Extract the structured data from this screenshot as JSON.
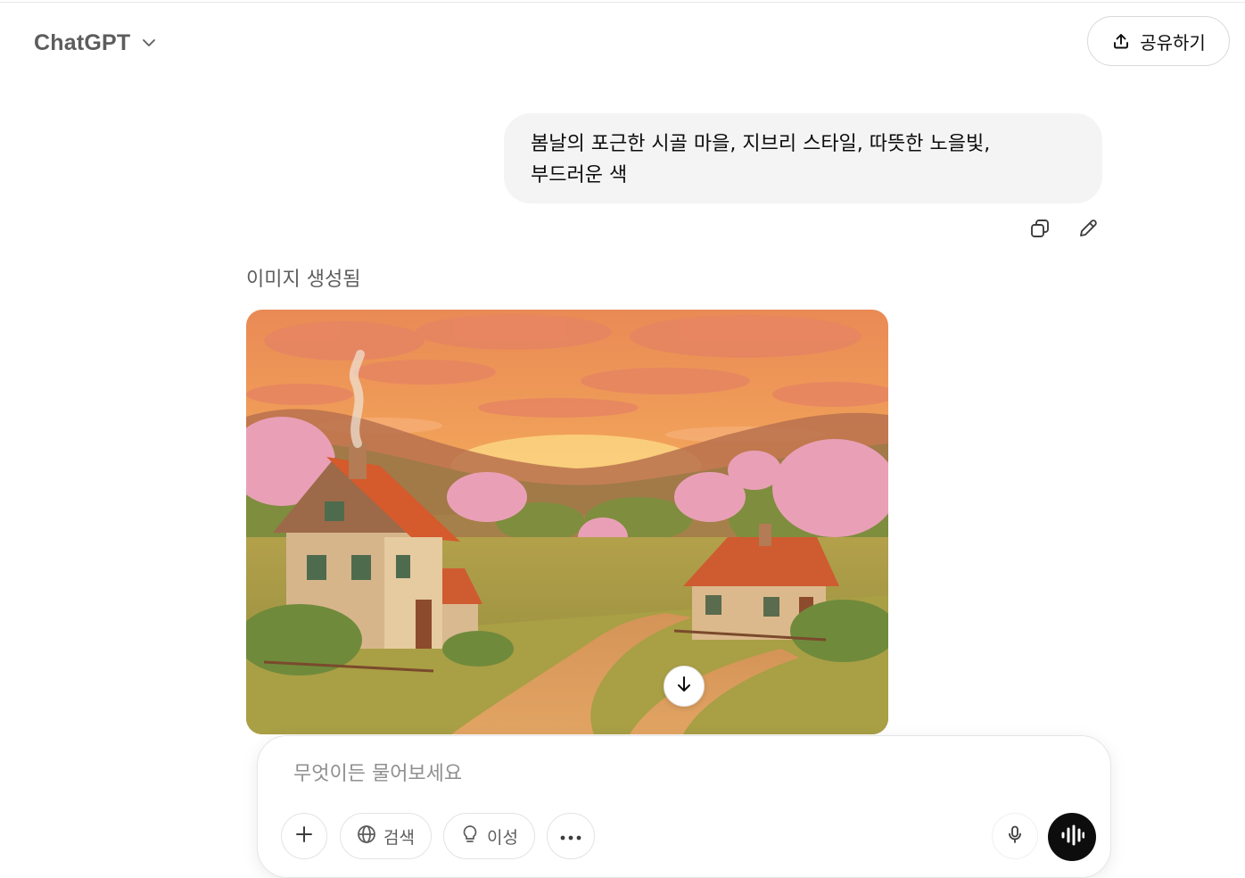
{
  "header": {
    "model_name": "ChatGPT",
    "share_label": "공유하기"
  },
  "conversation": {
    "user_message_lines": [
      "봄날의 포근한 시골 마을, 지브리 스타일, 따뜻한 노을빛,",
      "부드러운 색"
    ],
    "generated_label": "이미지 생성됨"
  },
  "composer": {
    "placeholder": "무엇이든 물어보세요",
    "search_label": "검색",
    "reason_label": "이성"
  },
  "icons": {
    "model": "chevron-down-icon",
    "share": "upload-icon",
    "copy": "copy-icon",
    "edit": "pencil-icon",
    "scroll": "arrow-down-icon",
    "add": "plus-icon",
    "search": "globe-icon",
    "reason": "lightbulb-icon",
    "more": "more-horizontal-icon",
    "mic": "microphone-icon",
    "voice": "waveform-icon"
  },
  "colors": {
    "bubble_bg": "#f4f4f4",
    "voice_button_bg": "#0d0d0d",
    "muted_text": "#5d5d5d"
  }
}
